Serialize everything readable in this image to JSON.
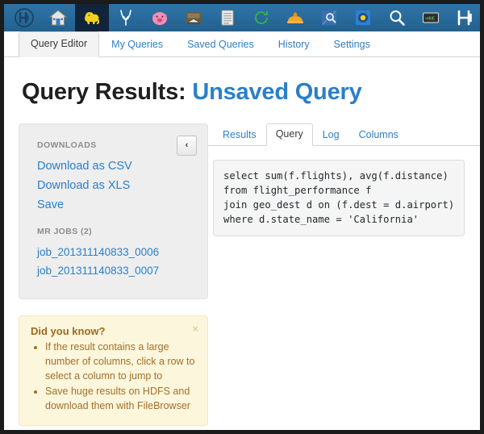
{
  "window": {
    "frame_color": "#1b1b1b",
    "background": "#ffffff"
  },
  "navbar": {
    "background": "#286090",
    "active_background": "#12243a",
    "icons": [
      {
        "name": "hue-logo-icon",
        "title": "Hue",
        "active": false
      },
      {
        "name": "home-icon",
        "title": "Home",
        "active": false
      },
      {
        "name": "hive-beeswax-elephant-icon",
        "title": "Hive Query Editor",
        "active": true
      },
      {
        "name": "impala-icon",
        "title": "Impala",
        "active": false
      },
      {
        "name": "pig-icon",
        "title": "Pig",
        "active": false
      },
      {
        "name": "file-browser-icon",
        "title": "File Browser",
        "active": false
      },
      {
        "name": "job-browser-icon",
        "title": "Job Browser",
        "active": false
      },
      {
        "name": "oozie-icon",
        "title": "Oozie",
        "active": false
      },
      {
        "name": "job-designer-hardhat-icon",
        "title": "Job Designer",
        "active": false
      },
      {
        "name": "metastore-icon",
        "title": "Metastore Manager",
        "active": false
      },
      {
        "name": "hbase-icon",
        "title": "HBase",
        "active": false
      },
      {
        "name": "search-icon",
        "title": "Search",
        "active": false
      },
      {
        "name": "hue-shell-icon",
        "title": "Hue Shell",
        "active": false
      },
      {
        "name": "hdfs-icon",
        "title": "HDFS",
        "active": false
      },
      {
        "name": "sentry-icon",
        "title": "Security",
        "active": false
      }
    ]
  },
  "page_tabs": {
    "items": [
      {
        "label": "Query Editor",
        "active": true
      },
      {
        "label": "My Queries",
        "active": false
      },
      {
        "label": "Saved Queries",
        "active": false
      },
      {
        "label": "History",
        "active": false
      },
      {
        "label": "Settings",
        "active": false
      }
    ]
  },
  "heading": {
    "prefix": "Query Results:",
    "query_name": "Unsaved Query",
    "accent_color": "#2a7fc9"
  },
  "sidebar": {
    "downloads_label": "DOWNLOADS",
    "download_links": [
      {
        "label": "Download as CSV",
        "name": "download-csv-link"
      },
      {
        "label": "Download as XLS",
        "name": "download-xls-link"
      },
      {
        "label": "Save",
        "name": "save-link"
      }
    ],
    "mr_jobs_label": "MR JOBS (2)",
    "mr_jobs": [
      {
        "label": "job_201311140833_0006"
      },
      {
        "label": "job_201311140833_0007"
      }
    ],
    "collapse_icon": "‹"
  },
  "tip": {
    "title": "Did you know?",
    "close_icon": "×",
    "items": [
      "If the result contains a large number of columns, click a row to select a column to jump to",
      "Save huge results on HDFS and download them with FileBrowser"
    ],
    "background": "#fcf6dd",
    "text_color": "#a1702a"
  },
  "result_tabs": {
    "items": [
      {
        "label": "Results",
        "active": false
      },
      {
        "label": "Query",
        "active": true
      },
      {
        "label": "Log",
        "active": false
      },
      {
        "label": "Columns",
        "active": false
      }
    ]
  },
  "query": {
    "sql": "select sum(f.flights), avg(f.distance)\nfrom flight_performance f\njoin geo_dest d on (f.dest = d.airport)\nwhere d.state_name = 'California'"
  }
}
